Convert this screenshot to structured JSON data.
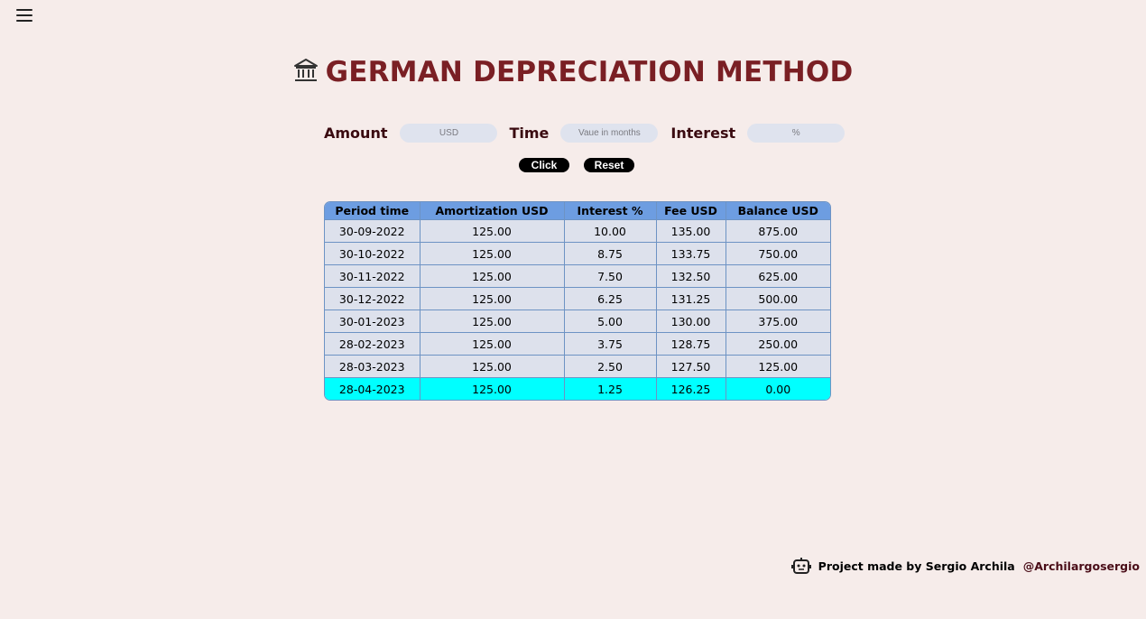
{
  "title": "GERMAN DEPRECIATION METHOD",
  "title_icon": "bank-icon",
  "form": {
    "amount_label": "Amount",
    "amount_placeholder": "USD",
    "time_label": "Time",
    "time_placeholder": "Vaue in months",
    "interest_label": "Interest",
    "interest_placeholder": "%"
  },
  "buttons": {
    "click_label": "Click",
    "reset_label": "Reset"
  },
  "table": {
    "headers": [
      "Period time",
      "Amortization USD",
      "Interest %",
      "Fee USD",
      "Balance USD"
    ],
    "rows": [
      [
        "30-09-2022",
        "125.00",
        "10.00",
        "135.00",
        "875.00"
      ],
      [
        "30-10-2022",
        "125.00",
        "8.75",
        "133.75",
        "750.00"
      ],
      [
        "30-11-2022",
        "125.00",
        "7.50",
        "132.50",
        "625.00"
      ],
      [
        "30-12-2022",
        "125.00",
        "6.25",
        "131.25",
        "500.00"
      ],
      [
        "30-01-2023",
        "125.00",
        "5.00",
        "130.00",
        "375.00"
      ],
      [
        "28-02-2023",
        "125.00",
        "3.75",
        "128.75",
        "250.00"
      ],
      [
        "28-03-2023",
        "125.00",
        "2.50",
        "127.50",
        "125.00"
      ],
      [
        "28-04-2023",
        "125.00",
        "1.25",
        "126.25",
        "0.00"
      ]
    ]
  },
  "footer": {
    "text": "Project made by Sergio Archila",
    "link": "@Archilargosergio",
    "icon": "robot-icon"
  },
  "colors": {
    "background": "#f6ecea",
    "title": "#7a1f24",
    "table_header": "#6d9de1",
    "table_cell": "#dde1ec",
    "final_row": "#00ffff"
  }
}
